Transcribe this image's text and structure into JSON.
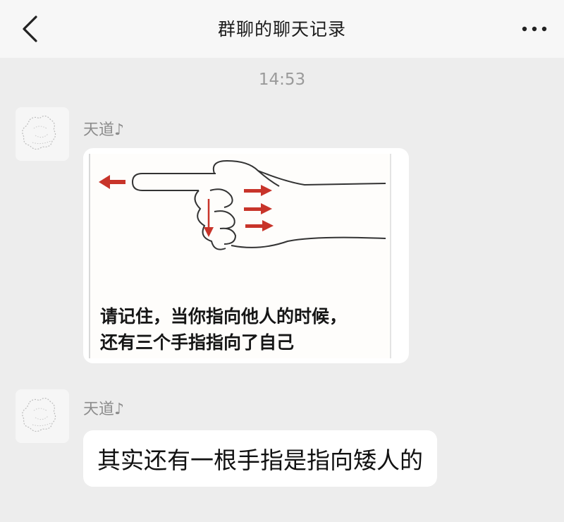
{
  "header": {
    "title": "群聊的聊天记录",
    "back_icon": "chevron-left-icon",
    "more_icon": "more-dots-icon"
  },
  "timestamp": "14:53",
  "messages": [
    {
      "sender": "天道♪",
      "type": "image",
      "image_caption": [
        "请记住，当你指向他人的时候，",
        "还有三个手指指向了自己"
      ]
    },
    {
      "sender": "天道♪",
      "type": "text",
      "text": "其实还有一根手指是指向矮人的"
    }
  ],
  "colors": {
    "background": "#ededed",
    "header": "#f7f7f7",
    "bubble": "#ffffff",
    "arrow_red": "#c8342a"
  }
}
